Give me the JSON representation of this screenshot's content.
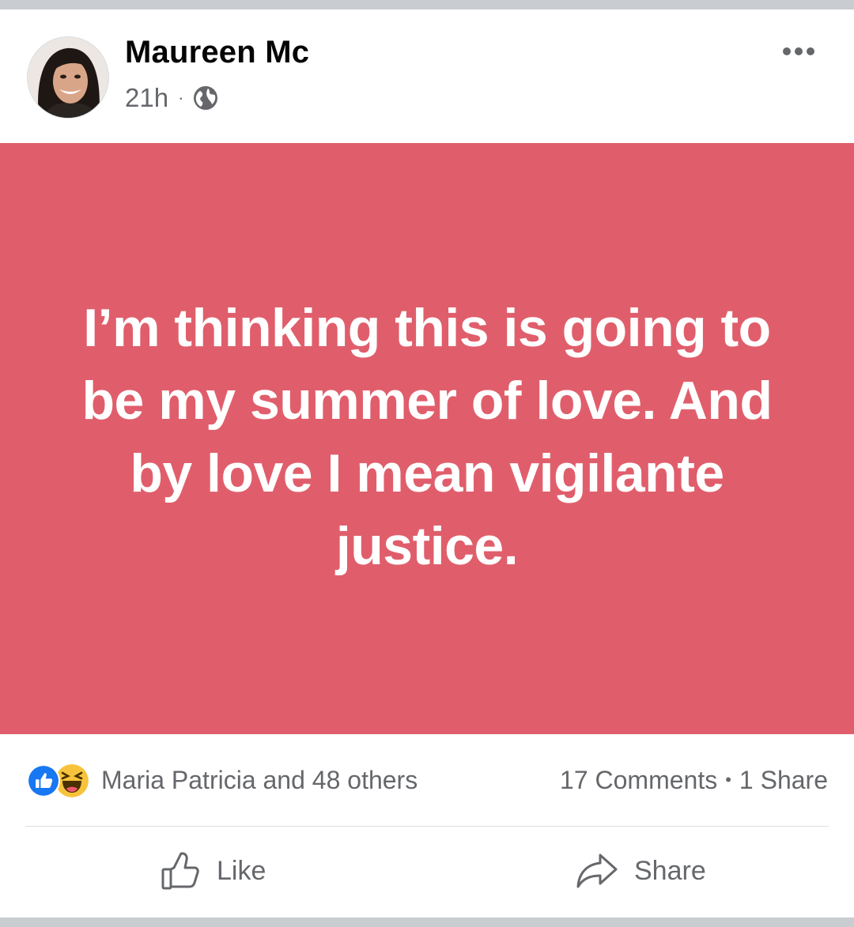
{
  "post": {
    "author": "Maureen Mc",
    "time": "21h",
    "dot": "·",
    "privacy_icon": "globe-icon",
    "menu_icon": "more-dots-icon",
    "text": "I’m thinking this is going to be my summer of love. And by love I mean vigilante justice.",
    "background_color": "#e05e6b",
    "text_color": "#ffffff"
  },
  "reactions": {
    "icons": [
      "like-reaction-icon",
      "haha-reaction-icon"
    ],
    "summary": "Maria Patricia and 48 others",
    "comments": "17 Comments",
    "separator": "•",
    "shares": "1 Share"
  },
  "actions": {
    "like_label": "Like",
    "share_label": "Share"
  },
  "colors": {
    "meta_gray": "#65676b",
    "like_blue": "#1877f2",
    "haha_yellow": "#f7c33c"
  }
}
